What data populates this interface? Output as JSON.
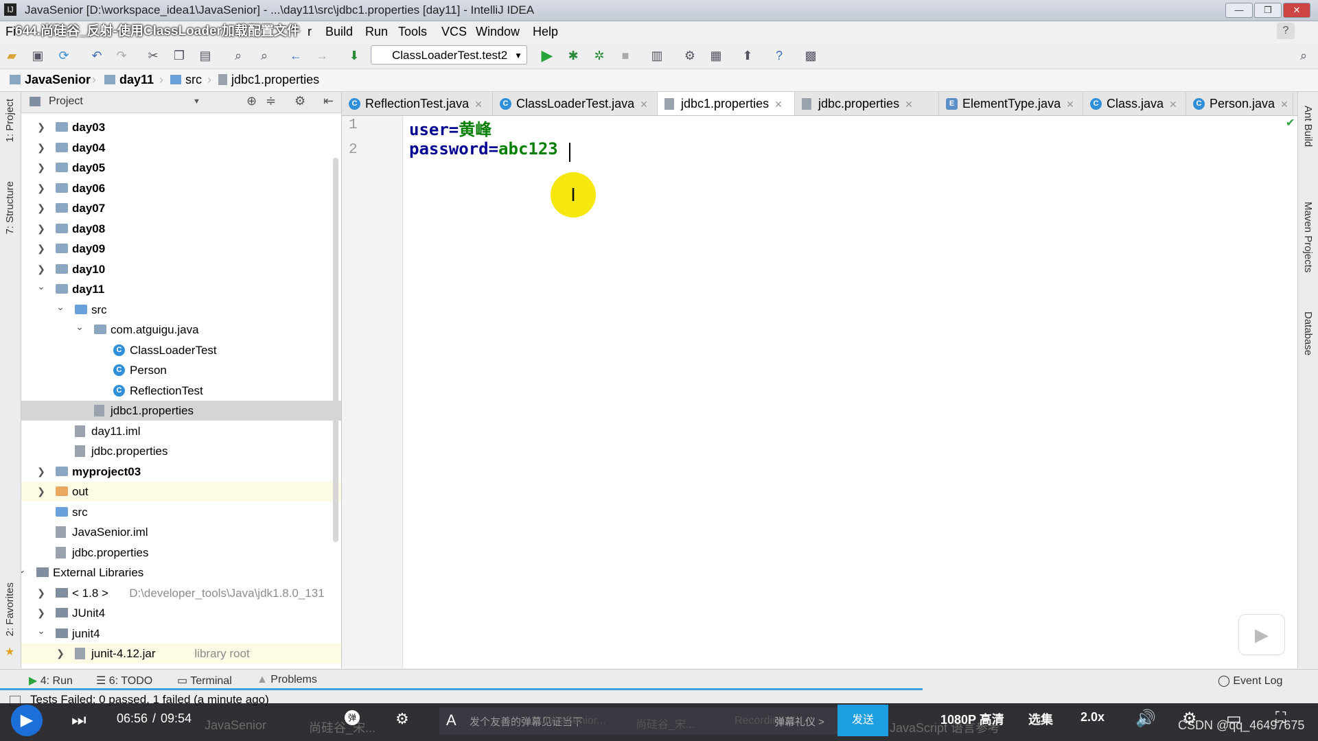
{
  "window": {
    "title": "JavaSenior [D:\\workspace_idea1\\JavaSenior] - ...\\day11\\src\\jdbc1.properties [day11] - IntelliJ IDEA",
    "video_overlay_title": "644.尚硅谷_反射-使用ClassLoader加载配置文件"
  },
  "menu": [
    "Build",
    "Run",
    "Tools",
    "VCS",
    "Window",
    "Help"
  ],
  "menu_partial": [
    "Fi",
    "r"
  ],
  "toolbar": {
    "run_config": "ClassLoaderTest.test2"
  },
  "breadcrumb": [
    "JavaSenior",
    "day11",
    "src",
    "jdbc1.properties"
  ],
  "left_strip": {
    "project": "1: Project",
    "structure": "7: Structure",
    "favorites": "2: Favorites"
  },
  "right_strip": {
    "ant": "Ant Build",
    "maven": "Maven Projects",
    "database": "Database"
  },
  "project_panel": {
    "header": "Project",
    "rows": [
      {
        "label": "day03"
      },
      {
        "label": "day04"
      },
      {
        "label": "day05"
      },
      {
        "label": "day06"
      },
      {
        "label": "day07"
      },
      {
        "label": "day08"
      },
      {
        "label": "day09"
      },
      {
        "label": "day10"
      },
      {
        "label": "day11"
      },
      {
        "label": "src"
      },
      {
        "label": "com.atguigu.java"
      },
      {
        "label": "ClassLoaderTest"
      },
      {
        "label": "Person"
      },
      {
        "label": "ReflectionTest"
      },
      {
        "label": "jdbc1.properties"
      },
      {
        "label": "day11.iml"
      },
      {
        "label": "jdbc.properties"
      },
      {
        "label": "myproject03"
      },
      {
        "label": "out"
      },
      {
        "label": "src"
      },
      {
        "label": "JavaSenior.iml"
      },
      {
        "label": "jdbc.properties"
      },
      {
        "label": "External Libraries"
      },
      {
        "label": "< 1.8 >",
        "extra": "D:\\developer_tools\\Java\\jdk1.8.0_131"
      },
      {
        "label": "JUnit4"
      },
      {
        "label": "junit4"
      },
      {
        "label": "junit-4.12.jar",
        "extra": "library root"
      }
    ]
  },
  "editor": {
    "tabs": [
      {
        "label": "ReflectionTest.java",
        "icon": "C"
      },
      {
        "label": "ClassLoaderTest.java",
        "icon": "C"
      },
      {
        "label": "jdbc1.properties",
        "icon": "P"
      },
      {
        "label": "jdbc.properties",
        "icon": "P"
      },
      {
        "label": "ElementType.java",
        "icon": "E"
      },
      {
        "label": "Class.java",
        "icon": "C"
      },
      {
        "label": "Person.java",
        "icon": "C"
      }
    ],
    "active_tab": "jdbc1.properties",
    "lines": [
      {
        "num": "1",
        "key": "user=",
        "value": "黄峰"
      },
      {
        "num": "2",
        "key": "password=",
        "value": "abc123"
      }
    ]
  },
  "bottom_tools": [
    "4: Run",
    "6: TODO",
    "Terminal",
    "Problems",
    "Event Log"
  ],
  "status": {
    "message": "Tests Failed: 0 passed, 1 failed (a minute ago)"
  },
  "player": {
    "time_current": "06:56",
    "time_sep": "/",
    "time_total": "09:54",
    "progress": 0.7,
    "quality": "1080P 高清",
    "episodes": "选集",
    "speed": "2.0x",
    "send": "发送",
    "danmaku_placeholder": "发个友善的弹幕见证当下",
    "danmaku_etiquette": "弹幕礼仪 >",
    "watermark": "CSDN @qq_46497675",
    "taskbar_items": [
      "JavaSenior",
      "尚硅谷_宋...",
      "JavaSenior...",
      "尚硅谷_宋...",
      "Recording...",
      "JavaScript 语言参考"
    ]
  },
  "colors": {
    "key": "#000091",
    "value": "#007f00",
    "accent": "#3da1e0",
    "pointer": "#f6e80f"
  }
}
